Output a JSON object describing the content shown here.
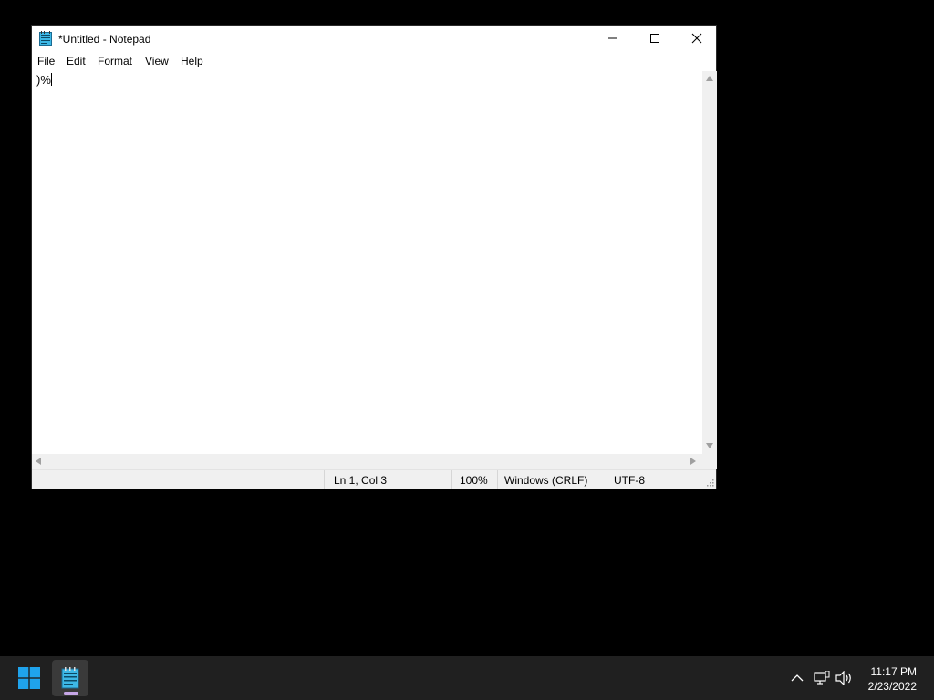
{
  "window": {
    "title": "*Untitled - Notepad",
    "controls": {
      "minimize": "minimize",
      "maximize": "maximize",
      "close": "close"
    }
  },
  "menu": {
    "items": [
      {
        "label": "File"
      },
      {
        "label": "Edit"
      },
      {
        "label": "Format"
      },
      {
        "label": "View"
      },
      {
        "label": "Help"
      }
    ]
  },
  "editor": {
    "content": ")%"
  },
  "status": {
    "position": "Ln 1, Col 3",
    "zoom": "100%",
    "line_ending": "Windows (CRLF)",
    "encoding": "UTF-8"
  },
  "taskbar": {
    "clock": {
      "time": "11:17 PM",
      "date": "2/23/2022"
    },
    "icons": [
      "windows-start-icon",
      "notepad-icon",
      "chevron-up-icon",
      "network-icon",
      "volume-icon"
    ]
  },
  "colors": {
    "taskbar_bg": "#202020",
    "start_accent": "#1fa3ec",
    "indicator": "#c6a6e6"
  }
}
